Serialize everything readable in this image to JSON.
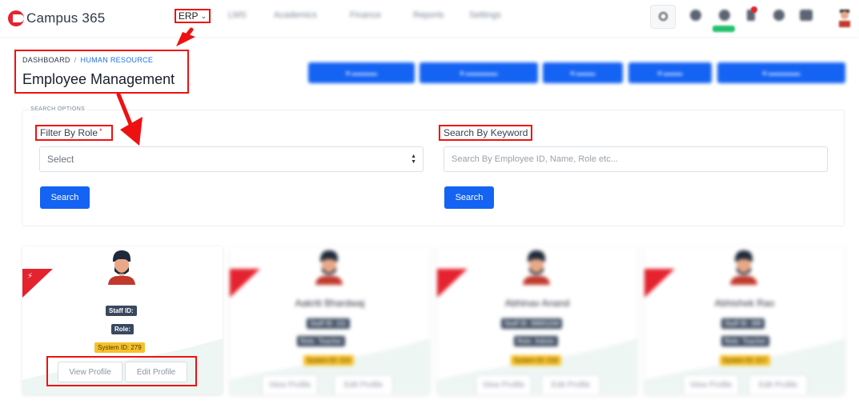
{
  "brand": {
    "name": "Campus 365",
    "accent": "#e4232f",
    "primary": "#1463f3"
  },
  "nav": {
    "active": "ERP",
    "items": [
      "LMS",
      "Academics",
      "Finance",
      "Reports",
      "Settings"
    ],
    "icons": [
      "search-icon",
      "globe-icon",
      "bell-icon",
      "notification-icon",
      "gear-icon",
      "message-icon",
      "user-avatar"
    ]
  },
  "breadcrumb": {
    "root": "DASHBOARD",
    "separator": "/",
    "current": "HUMAN RESOURCE"
  },
  "page_title": "Employee Management",
  "search": {
    "section_label": "SEARCH OPTIONS",
    "role_label": "Filter By Role",
    "role_required": "*",
    "role_select_value": "Select",
    "keyword_label": "Search By Keyword",
    "keyword_placeholder": "Search By Employee ID, Name, Role etc...",
    "button_label": "Search"
  },
  "employees": [
    {
      "name": "",
      "staff_id_label": "Staff ID:",
      "role_label": "Role:",
      "system_id": "System ID: 279",
      "view_label": "View Profile",
      "edit_label": "Edit Profile"
    },
    {
      "name": "Aakriti Bhardwaj",
      "staff_id_label": "Staff ID: 211",
      "role_label": "Role: Teacher",
      "system_id": "System ID: 215",
      "view_label": "View Profile",
      "edit_label": "Edit Profile"
    },
    {
      "name": "Abhinav Anand",
      "staff_id_label": "Staff ID: 00001234",
      "role_label": "Role: Admin",
      "system_id": "System ID: 216",
      "view_label": "View Profile",
      "edit_label": "Edit Profile"
    },
    {
      "name": "Abhishek Rao",
      "staff_id_label": "Staff ID: 309",
      "role_label": "Role: Teacher",
      "system_id": "System ID: 217",
      "view_label": "View Profile",
      "edit_label": "Edit Profile"
    }
  ]
}
